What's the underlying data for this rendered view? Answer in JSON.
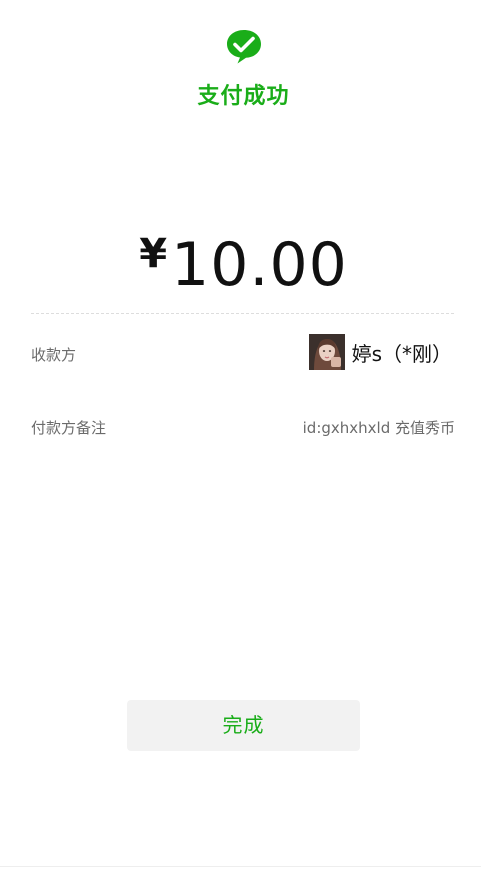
{
  "header": {
    "icon": "wechat-pay-check-icon",
    "status_text": "支付成功",
    "accent_color": "#1aad19"
  },
  "payment": {
    "currency_symbol": "¥",
    "amount": "10.00"
  },
  "details": {
    "payee_label": "收款方",
    "payee_name": "婷s（*刚）",
    "payee_avatar": "avatar-photo",
    "memo_label": "付款方备注",
    "memo_value": "id:gxhxhxld 充值秀币"
  },
  "actions": {
    "done_label": "完成"
  }
}
